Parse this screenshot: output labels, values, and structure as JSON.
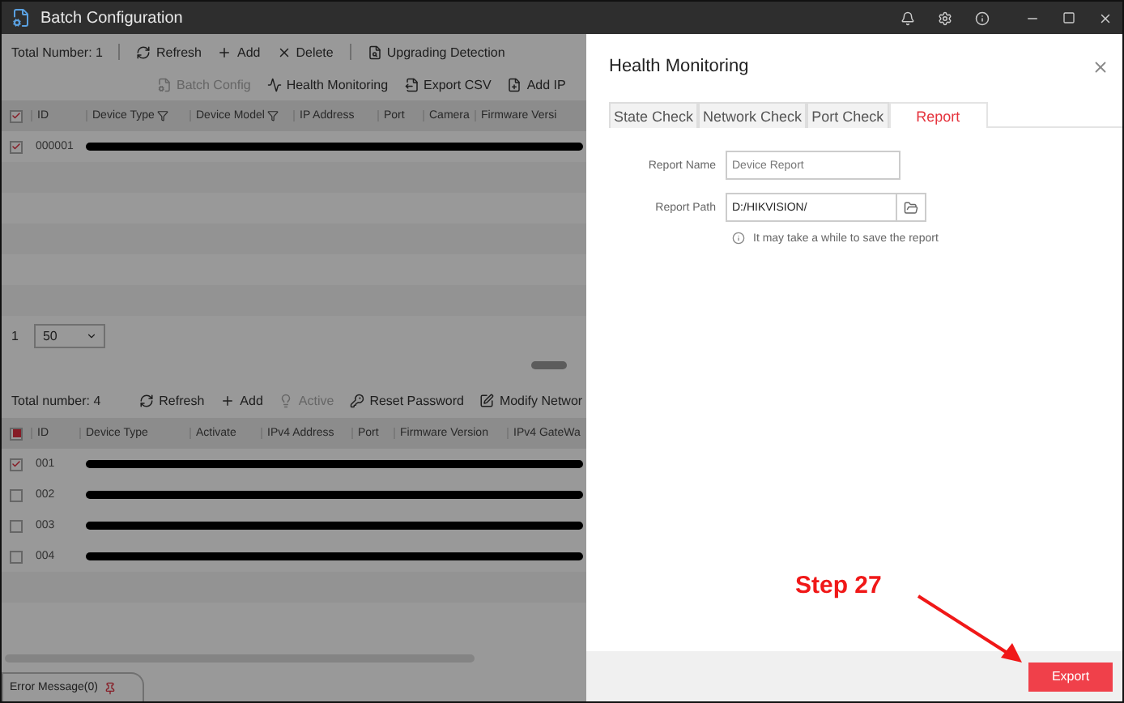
{
  "window": {
    "title": "Batch Configuration"
  },
  "upper_panel": {
    "total": "Total Number: 1",
    "toolbar": [
      {
        "label": "Refresh",
        "disabled": false
      },
      {
        "label": "Add",
        "disabled": false
      },
      {
        "label": "Delete",
        "disabled": false
      },
      {
        "label": "Upgrading Detection",
        "disabled": false
      }
    ],
    "toolbar2": [
      {
        "label": "Batch Config",
        "disabled": true
      },
      {
        "label": "Health Monitoring",
        "disabled": false
      },
      {
        "label": "Export CSV",
        "disabled": false
      },
      {
        "label": "Add IP",
        "disabled": false
      }
    ],
    "header_checkbox": {
      "checked": true
    },
    "columns": [
      "ID",
      "Device Type",
      "Device Model",
      "IP Address",
      "Port",
      "Camera",
      "Firmware Versi"
    ],
    "rows": [
      {
        "id": "000001",
        "checked": true
      }
    ]
  },
  "pagination": {
    "page": "1",
    "page_size": "50"
  },
  "lower_panel": {
    "total": "Total number: 4",
    "toolbar": [
      {
        "label": "Refresh",
        "disabled": false
      },
      {
        "label": "Add",
        "disabled": false
      },
      {
        "label": "Active",
        "disabled": true
      },
      {
        "label": "Reset Password",
        "disabled": false
      },
      {
        "label": "Modify Networ",
        "disabled": false
      }
    ],
    "header_checkbox": {
      "partial": true
    },
    "columns": [
      "ID",
      "Device Type",
      "Activate",
      "IPv4 Address",
      "Port",
      "Firmware Version",
      "IPv4 GateWa"
    ],
    "rows": [
      {
        "id": "001",
        "checked": true
      },
      {
        "id": "002",
        "checked": false
      },
      {
        "id": "003",
        "checked": false
      },
      {
        "id": "004",
        "checked": false
      }
    ]
  },
  "error_tab": "Error Message(0)",
  "drawer": {
    "title": "Health Monitoring",
    "tabs": [
      {
        "label": "State Check",
        "selected": false
      },
      {
        "label": "Network Check",
        "selected": false
      },
      {
        "label": "Port Check",
        "selected": false
      },
      {
        "label": "Report",
        "selected": true
      }
    ],
    "fields": [
      {
        "label": "Report Name",
        "kind": "text",
        "placeholder": "Device Report"
      },
      {
        "label": "Report Path",
        "kind": "path",
        "value": "D:/HIKVISION/"
      }
    ],
    "note": "It may take a while to save the report",
    "export_button": "Export"
  },
  "annotation": {
    "text": "Step 27"
  }
}
